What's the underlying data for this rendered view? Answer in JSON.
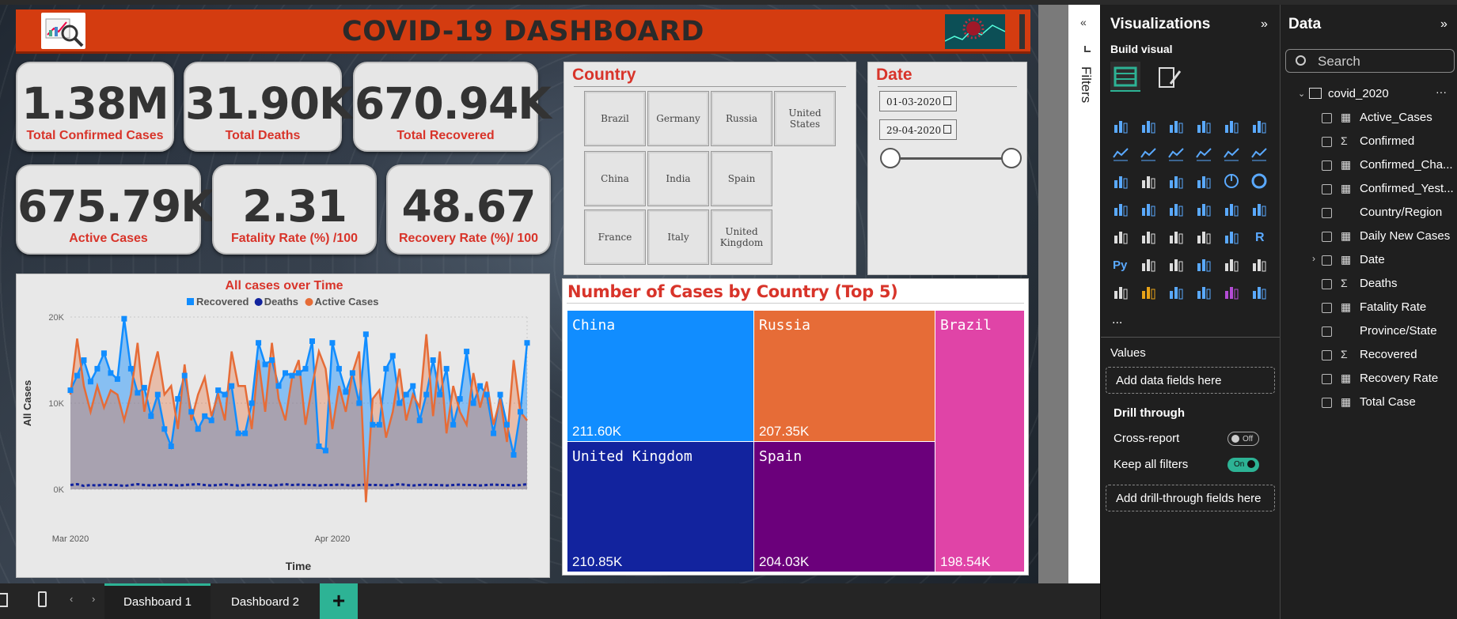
{
  "report": {
    "title": "COVID-19 DASHBOARD",
    "kpis": [
      {
        "value": "1.38M",
        "label": "Total Confirmed Cases"
      },
      {
        "value": "31.90K",
        "label": "Total Deaths"
      },
      {
        "value": "670.94K",
        "label": "Total Recovered"
      },
      {
        "value": "675.79K",
        "label": "Active  Cases"
      },
      {
        "value": "2.31",
        "label": "Fatality Rate (%) /100"
      },
      {
        "value": "48.67",
        "label": "Recovery Rate (%)/ 100"
      }
    ],
    "country_slicer": {
      "title": "Country",
      "items": [
        "Brazil",
        "Germany",
        "Russia",
        "United States",
        "China",
        "India",
        "Spain",
        "France",
        "Italy",
        "United Kingdom"
      ]
    },
    "date_slicer": {
      "title": "Date",
      "start": "01-03-2020",
      "end": "29-04-2020"
    },
    "treemap": {
      "title": "Number of Cases by Country (Top 5)",
      "cells": [
        {
          "name": "China",
          "value": "211.60K",
          "color": "#118dff"
        },
        {
          "name": "Russia",
          "value": "207.35K",
          "color": "#e66c37"
        },
        {
          "name": "Brazil",
          "value": "198.54K",
          "color": "#e044a7"
        },
        {
          "name": "United Kingdom",
          "value": "210.85K",
          "color": "#12239e"
        },
        {
          "name": "Spain",
          "value": "204.03K",
          "color": "#6b007b"
        }
      ]
    }
  },
  "chart_data": {
    "type": "line",
    "title": "All cases over Time",
    "xlabel": "Time",
    "ylabel": "All Cases",
    "x_ticks": [
      "Mar 2020",
      "Apr 2020"
    ],
    "y_ticks": [
      "20K",
      "10K",
      "0K"
    ],
    "ylim": [
      0,
      20000
    ],
    "legend": "top-center",
    "grid": true,
    "series": [
      {
        "name": "Recovered",
        "color": "#118dff",
        "area": true,
        "values": [
          11500,
          13200,
          15000,
          12500,
          14000,
          15800,
          13500,
          12800,
          19800,
          14000,
          11200,
          11800,
          8500,
          11000,
          7000,
          5000,
          10500,
          13200,
          9000,
          7000,
          8500,
          8000,
          11500,
          11000,
          12000,
          6500,
          6500,
          10000,
          17000,
          14500,
          15000,
          12000,
          13500,
          13200,
          13500,
          14000,
          17200,
          5000,
          4500,
          17000,
          14000,
          11300,
          13500,
          10000,
          18000,
          7500,
          7500,
          14000,
          15500,
          10000,
          11000,
          12000,
          8000,
          11000,
          15000,
          11000,
          14000,
          7500,
          10500,
          16000,
          10000,
          12000,
          11000,
          6500,
          11000,
          7500,
          4000,
          9000,
          17000
        ]
      },
      {
        "name": "Deaths",
        "color": "#12239e",
        "area": false,
        "dashed": true,
        "values": [
          500,
          600,
          400,
          500,
          450,
          550,
          500,
          500,
          400,
          500,
          600,
          500,
          450,
          500,
          550,
          500,
          450,
          500,
          550,
          600,
          500,
          450,
          500,
          600,
          500,
          450,
          500,
          550,
          500,
          500,
          450,
          500,
          600,
          500,
          550,
          500,
          500,
          450,
          500,
          500,
          550,
          500,
          450,
          500,
          550,
          500,
          500,
          450,
          500,
          600,
          500,
          450,
          500,
          550,
          500,
          500,
          450,
          500,
          550,
          500,
          500,
          450,
          500,
          550,
          500,
          500,
          450,
          500,
          600
        ]
      },
      {
        "name": "Active Cases",
        "color": "#e66c37",
        "area": true,
        "values": [
          11000,
          17500,
          12000,
          9000,
          12000,
          9500,
          11500,
          11000,
          8000,
          11000,
          17000,
          9000,
          13000,
          16000,
          11000,
          12000,
          7000,
          14500,
          8000,
          11000,
          13000,
          8500,
          11000,
          8000,
          16000,
          12000,
          12000,
          7000,
          15000,
          9000,
          17000,
          10500,
          8000,
          13000,
          15000,
          7500,
          12000,
          16000,
          14000,
          7000,
          12000,
          9000,
          13500,
          16000,
          -1500,
          10500,
          11500,
          6000,
          9000,
          14000,
          8000,
          11000,
          9500,
          18000,
          8500,
          16000,
          6500,
          12000,
          9000,
          7500,
          13500,
          9500,
          12500,
          7500,
          10500,
          5500,
          15000,
          9000,
          8000
        ]
      }
    ]
  },
  "filters_pane": {
    "label": "Filters"
  },
  "viz_pane": {
    "title": "Visualizations",
    "build_visual": "Build visual",
    "values_label": "Values",
    "add_data": "Add data fields here",
    "drill_through": "Drill through",
    "cross_report": "Cross-report",
    "cross_report_state": "Off",
    "keep_filters": "Keep all filters",
    "keep_filters_state": "On",
    "add_drill": "Add drill-through fields here",
    "more": "..."
  },
  "data_pane": {
    "title": "Data",
    "search_placeholder": "Search",
    "table": "covid_2020",
    "fields": [
      {
        "name": "Active_Cases",
        "icon": "calc"
      },
      {
        "name": "Confirmed",
        "icon": "sigma"
      },
      {
        "name": "Confirmed_Cha...",
        "icon": "calc"
      },
      {
        "name": "Confirmed_Yest...",
        "icon": "calc"
      },
      {
        "name": "Country/Region",
        "icon": "none"
      },
      {
        "name": "Daily New Cases",
        "icon": "calc"
      },
      {
        "name": "Date",
        "icon": "calc"
      },
      {
        "name": "Deaths",
        "icon": "sigma"
      },
      {
        "name": "Fatality Rate",
        "icon": "calc"
      },
      {
        "name": "Province/State",
        "icon": "none"
      },
      {
        "name": "Recovered",
        "icon": "sigma"
      },
      {
        "name": "Recovery Rate",
        "icon": "calc"
      },
      {
        "name": "Total Case",
        "icon": "calc"
      }
    ]
  },
  "pages": {
    "tabs": [
      "Dashboard 1",
      "Dashboard 2"
    ],
    "add": "+"
  }
}
